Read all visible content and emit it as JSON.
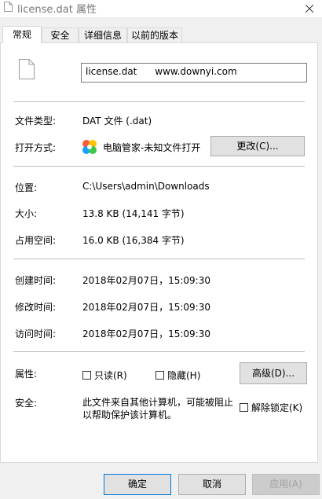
{
  "window": {
    "title": "license.dat 属性"
  },
  "tabs": [
    "常规",
    "安全",
    "详细信息",
    "以前的版本"
  ],
  "general": {
    "filename": "license.dat      www.downyi.com",
    "file_type_label": "文件类型:",
    "file_type_value": "DAT 文件 (.dat)",
    "opens_with_label": "打开方式:",
    "opens_with_value": "电脑管家-未知文件打开",
    "change_button": "更改(C)...",
    "location_label": "位置:",
    "location_value": "C:\\Users\\admin\\Downloads",
    "size_label": "大小:",
    "size_value": "13.8 KB (14,141 字节)",
    "size_on_disk_label": "占用空间:",
    "size_on_disk_value": "16.0 KB (16,384 字节)",
    "created_label": "创建时间:",
    "created_value": "2018年02月07日，15:09:30",
    "modified_label": "修改时间:",
    "modified_value": "2018年02月07日，15:09:30",
    "accessed_label": "访问时间:",
    "accessed_value": "2018年02月07日，15:09:30",
    "attributes_label": "属性:",
    "readonly_label": "只读(R)",
    "hidden_label": "隐藏(H)",
    "advanced_button": "高级(D)...",
    "security_label": "安全:",
    "security_text_1": "此文件来自其他计算机，可能被阻止",
    "security_text_2": "以帮助保护该计算机。",
    "unblock_label": "解除锁定(K)"
  },
  "footer": {
    "ok_button": "确定",
    "cancel_button": "取消",
    "apply_button": "应用(A)"
  },
  "icons": {
    "title_icon": "document-icon",
    "file_icon": "document-icon",
    "app_icon": "tencent-pc-manager-icon",
    "close_icon": "close-icon"
  }
}
